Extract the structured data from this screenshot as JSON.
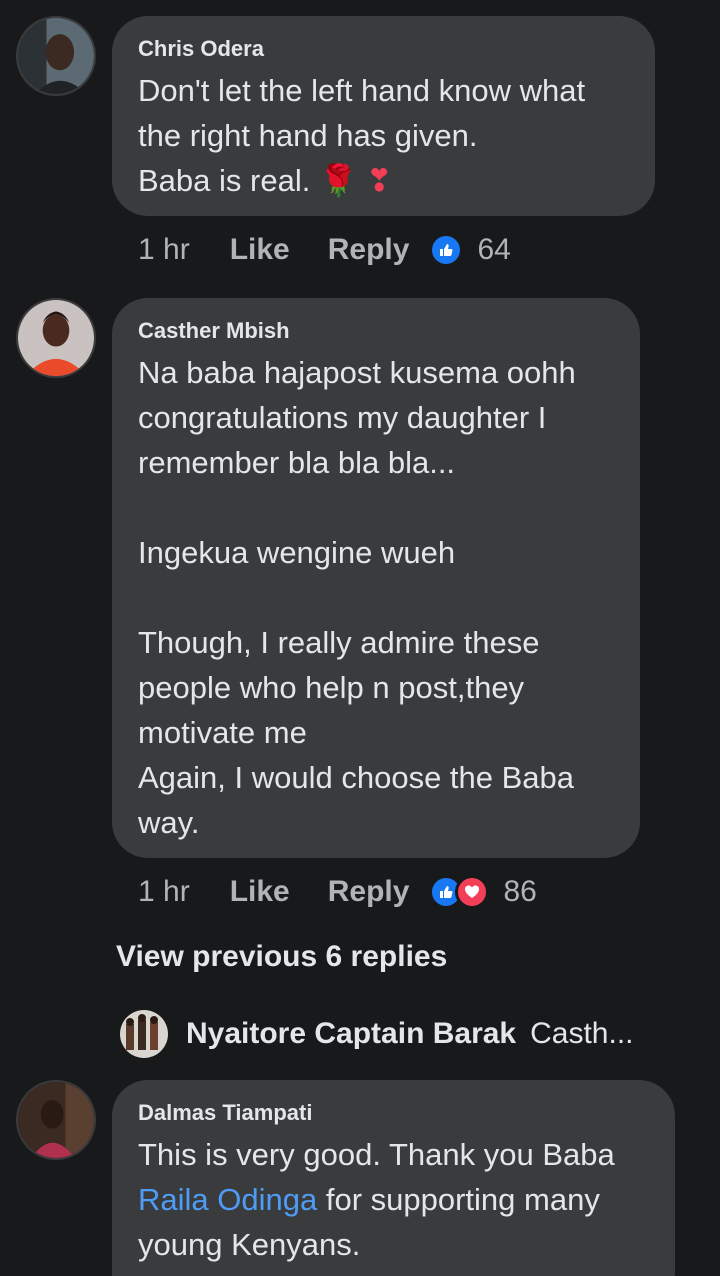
{
  "comments": [
    {
      "author": "Chris Odera",
      "text": "Don't let the left hand know what\nthe right hand has given.\nBaba is real.",
      "emoji": [
        "🌹",
        "❣"
      ],
      "time": "1 hr",
      "like_label": "Like",
      "reply_label": "Reply",
      "reaction_count": "64",
      "reactions": [
        "like-icon"
      ]
    },
    {
      "author": "Casther Mbish",
      "text": "Na baba hajapost kusema oohh\ncongratulations my daughter I\nremember bla bla bla...\n\nIngekua wengine wueh\n\nThough, I really admire these\npeople who help n post,they\nmotivate me\nAgain, I would choose the Baba\nway.",
      "time": "1 hr",
      "like_label": "Like",
      "reply_label": "Reply",
      "reaction_count": "86",
      "reactions": [
        "like-icon",
        "love-icon"
      ]
    },
    {
      "author": "Dalmas Tiampati",
      "text_before": "This is very good. Thank you Baba",
      "link": "Raila Odinga",
      "text_after": "for supporting many\nyoung Kenyans."
    }
  ],
  "view_previous_label": "View previous 6 replies",
  "reply_preview": {
    "name": "Nyaitore Captain Barak",
    "snippet": "Casth..."
  },
  "colors": {
    "background": "#18191a",
    "bubble": "#3a3b3c",
    "text": "#e4e6eb",
    "muted": "#b0b3b8",
    "link": "#4e9cf5",
    "like": "#1877f2",
    "love": "#f33e58"
  }
}
